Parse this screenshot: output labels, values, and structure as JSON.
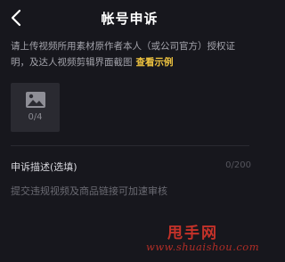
{
  "header": {
    "back_icon": "chevron-left-icon",
    "title": "帐号申诉"
  },
  "instruction": {
    "text": "请上传视频所用素材原作者本人（或公司官方）授权证明，及达人视频剪辑界面截图",
    "example_link": "查看示例"
  },
  "upload": {
    "icon": "image-icon",
    "count_label": "0/4"
  },
  "appeal": {
    "label": "申诉描述(选填)",
    "char_counter": "0/200",
    "placeholder": "提交违规视频及商品链接可加速审核",
    "value": ""
  },
  "watermark": {
    "name": "甩手网",
    "url": "www.shuaishou.com"
  },
  "colors": {
    "background": "#17171d",
    "accent_link": "#f1c540",
    "watermark_red": "#d8352b"
  }
}
